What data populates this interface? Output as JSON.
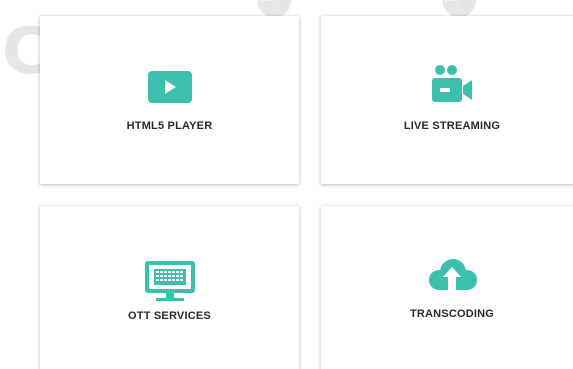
{
  "background": {
    "watermark_letter": "C"
  },
  "services": [
    {
      "label": "HTML5 PLAYER",
      "icon": "play-button-icon"
    },
    {
      "label": "LIVE STREAMING",
      "icon": "video-camera-icon"
    },
    {
      "label": "OTT SERVICES",
      "icon": "monitor-keyboard-icon"
    },
    {
      "label": "TRANSCODING",
      "icon": "cloud-upload-icon"
    }
  ],
  "colors": {
    "accent": "#3dbfae",
    "label_text": "#2a2a2a",
    "watermark": "#e6e6e9",
    "card_background": "#ffffff"
  }
}
